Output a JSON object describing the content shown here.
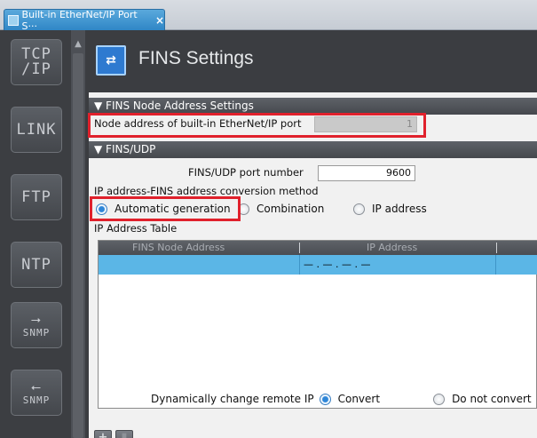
{
  "tab": {
    "title": "Built-in EtherNet/IP Port S···",
    "close": "×"
  },
  "nav": {
    "items": [
      {
        "label_top": "TCP",
        "label_bottom": "/IP"
      },
      {
        "label": "LINK"
      },
      {
        "label": "FTP"
      },
      {
        "label": "NTP"
      },
      {
        "arrow": "⭢",
        "label": "SNMP"
      },
      {
        "arrow": "⭠",
        "label": "SNMP"
      }
    ]
  },
  "header": {
    "title": "FINS Settings",
    "icon": "fins-icon"
  },
  "node_section": {
    "title": "▼ FINS Node Address Settings",
    "node_label": "Node address of built-in EtherNet/IP port",
    "node_value": "1"
  },
  "udp_section": {
    "title": "▼ FINS/UDP",
    "port_label": "FINS/UDP port number",
    "port_value": "9600",
    "conversion_label": "IP address-FINS address conversion method",
    "options": [
      "Automatic generation",
      "Combination",
      "IP address"
    ],
    "selected": "Automatic generation",
    "table_label": "IP Address Table"
  },
  "table": {
    "columns": [
      "FINS Node Address",
      "IP Address"
    ],
    "rows": [
      {
        "fins": "",
        "ip": "— . — . — . —"
      }
    ]
  },
  "toolbar": {
    "add": "+",
    "delete": "🗑"
  },
  "bottom": {
    "label": "Dynamically change remote IP",
    "options": [
      "Convert",
      "Do not convert"
    ],
    "selected": "Convert"
  },
  "colors": {
    "highlight": "#e0212c",
    "accent": "#5bb6e6"
  }
}
